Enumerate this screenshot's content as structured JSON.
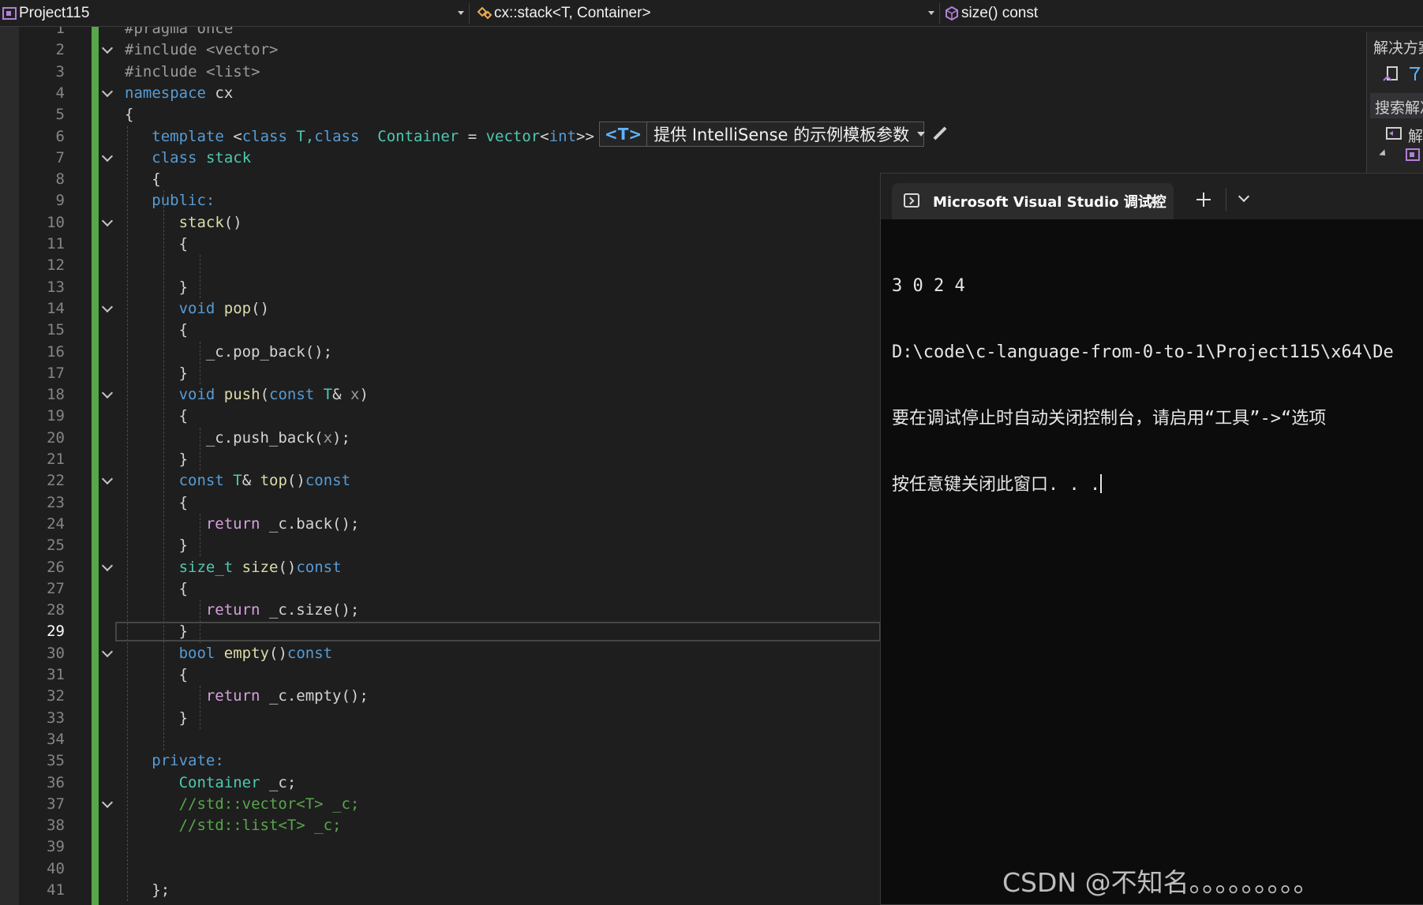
{
  "navbar": {
    "project": "Project115",
    "scope": "cx::stack<T, Container>",
    "member": "size() const"
  },
  "editor": {
    "current_line": 29,
    "lines": [
      {
        "n": "1"
      },
      {
        "n": "2"
      },
      {
        "n": "3"
      },
      {
        "n": "4"
      },
      {
        "n": "5"
      },
      {
        "n": "6"
      },
      {
        "n": "7"
      },
      {
        "n": "8"
      },
      {
        "n": "9"
      },
      {
        "n": "10"
      },
      {
        "n": "11"
      },
      {
        "n": "12"
      },
      {
        "n": "13"
      },
      {
        "n": "14"
      },
      {
        "n": "15"
      },
      {
        "n": "16"
      },
      {
        "n": "17"
      },
      {
        "n": "18"
      },
      {
        "n": "19"
      },
      {
        "n": "20"
      },
      {
        "n": "21"
      },
      {
        "n": "22"
      },
      {
        "n": "23"
      },
      {
        "n": "24"
      },
      {
        "n": "25"
      },
      {
        "n": "26"
      },
      {
        "n": "27"
      },
      {
        "n": "28"
      },
      {
        "n": "29"
      },
      {
        "n": "30"
      },
      {
        "n": "31"
      },
      {
        "n": "32"
      },
      {
        "n": "33"
      },
      {
        "n": "34"
      },
      {
        "n": "35"
      },
      {
        "n": "36"
      },
      {
        "n": "37"
      },
      {
        "n": "38"
      },
      {
        "n": "39"
      },
      {
        "n": "40"
      },
      {
        "n": "41"
      }
    ],
    "code": {
      "l1": "#pragma once",
      "l2": "#include <vector>",
      "l3": "#include <list>",
      "l4_kw": "namespace",
      "l4_name": "cx",
      "brace_open": "{",
      "brace_close": "}",
      "l6_template": "template",
      "l6_open": " <",
      "l6_class1": "class",
      "l6_T": " T,",
      "l6_class2": "class",
      "l6_container": "  Container",
      "l6_eq": " = ",
      "l6_vector": "vector",
      "l6_int_open": "<",
      "l6_int": "int",
      "l6_close": ">>",
      "l7_kw": "class",
      "l7_name": "stack",
      "l9": "public:",
      "l10": "stack",
      "parens": "()",
      "void": "void",
      "l14_fn": "pop",
      "l16": "_c.pop_back();",
      "l18_fn": "push",
      "l18_open": "(",
      "const": "const",
      "T": "T",
      "amp": "&",
      "l18_x": " x",
      "l18_close": ")",
      "l20_a": "_c.push_back(",
      "l20_x": "x",
      "l20_b": ");",
      "l22_fn": "top",
      "return": "return",
      "l24": " _c.back();",
      "size_t": "size_t",
      "l26_fn": "size",
      "l28": " _c.size();",
      "bool": "bool",
      "l30_fn": "empty",
      "l32": " _c.empty();",
      "l35": "private:",
      "l36_type": "Container",
      "l36_var": " _c;",
      "l37": "//std::vector<T> _c;",
      "l38": "//std::list<T> _c;",
      "l41": "};"
    }
  },
  "template_hint": {
    "badge": "<T>",
    "label": "提供 IntelliSense 的示例模板参数"
  },
  "solution_explorer": {
    "title": "解决方案",
    "search": "搜索解决",
    "item": "解"
  },
  "console": {
    "tab_title": "Microsoft Visual Studio 调试控",
    "output": [
      "3 0 2 4",
      "D:\\code\\c-language-from-0-to-1\\Project115\\x64\\De",
      "要在调试停止时自动关闭控制台，请启用“工具”->“选项",
      "按任意键关闭此窗口. . ."
    ]
  },
  "watermark": "CSDN @不知名。。。。。。。。。"
}
